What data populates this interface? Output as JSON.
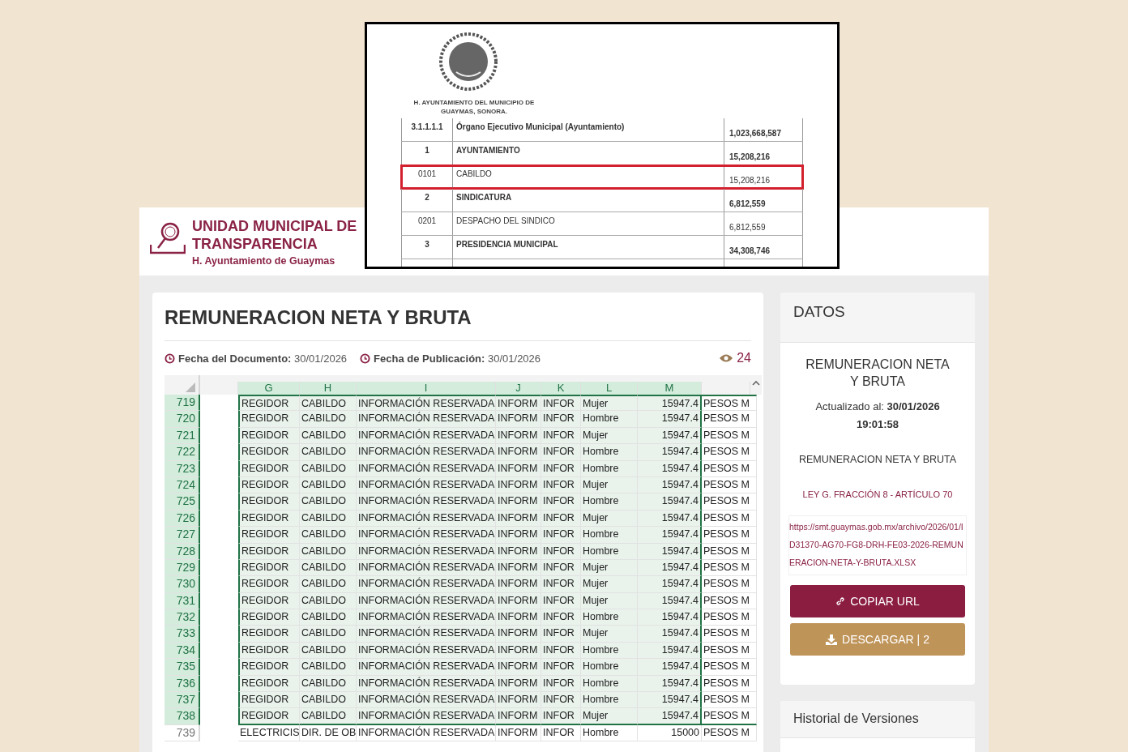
{
  "document_scan": {
    "issuer": "H. AYUNTAMIENTO DEL MUNICIPIO DE GUAYMAS, SONORA.",
    "rows": [
      {
        "code": "3.1.1.1.1",
        "name": "Órgano Ejecutivo Municipal (Ayuntamiento)",
        "amount": "1,023,668,587",
        "bold": true,
        "highlighted": false
      },
      {
        "code": "1",
        "name": "AYUNTAMIENTO",
        "amount": "15,208,216",
        "bold": true,
        "highlighted": false
      },
      {
        "code": "0101",
        "name": "CABILDO",
        "amount": "15,208,216",
        "bold": false,
        "highlighted": true
      },
      {
        "code": "2",
        "name": "SINDICATURA",
        "amount": "6,812,559",
        "bold": true,
        "highlighted": false
      },
      {
        "code": "0201",
        "name": "DESPACHO DEL SINDICO",
        "amount": "6,812,559",
        "bold": false,
        "highlighted": false
      },
      {
        "code": "3",
        "name": "PRESIDENCIA MUNICIPAL",
        "amount": "34,308,746",
        "bold": true,
        "highlighted": false
      }
    ]
  },
  "header": {
    "title_line1": "UNIDAD MUNICIPAL DE",
    "title_line2": "TRANSPARENCIA",
    "subtitle": "H. Ayuntamiento de Guaymas"
  },
  "document": {
    "title": "REMUNERACION NETA Y BRUTA",
    "doc_date_label": "Fecha del Documento:",
    "doc_date": "30/01/2026",
    "pub_date_label": "Fecha de Publicación:",
    "pub_date": "30/01/2026",
    "views": "24"
  },
  "sheet": {
    "columns": [
      "",
      "G",
      "H",
      "I",
      "J",
      "K",
      "L",
      "M"
    ],
    "rows": [
      {
        "num": "719",
        "selected": true,
        "cells": [
          "",
          "REGIDOR",
          "CABILDO",
          "INFORMACIÓN RESERVADA",
          "INFORM",
          "INFOR",
          "Mujer",
          "15947.4",
          "PESOS M"
        ]
      },
      {
        "num": "720",
        "selected": true,
        "cells": [
          "",
          "REGIDOR",
          "CABILDO",
          "INFORMACIÓN RESERVADA",
          "INFORM",
          "INFOR",
          "Hombre",
          "15947.4",
          "PESOS M"
        ]
      },
      {
        "num": "721",
        "selected": true,
        "cells": [
          "",
          "REGIDOR",
          "CABILDO",
          "INFORMACIÓN RESERVADA",
          "INFORM",
          "INFOR",
          "Mujer",
          "15947.4",
          "PESOS M"
        ]
      },
      {
        "num": "722",
        "selected": true,
        "cells": [
          "",
          "REGIDOR",
          "CABILDO",
          "INFORMACIÓN RESERVADA",
          "INFORM",
          "INFOR",
          "Hombre",
          "15947.4",
          "PESOS M"
        ]
      },
      {
        "num": "723",
        "selected": true,
        "cells": [
          "",
          "REGIDOR",
          "CABILDO",
          "INFORMACIÓN RESERVADA",
          "INFORM",
          "INFOR",
          "Hombre",
          "15947.4",
          "PESOS M"
        ]
      },
      {
        "num": "724",
        "selected": true,
        "cells": [
          "",
          "REGIDOR",
          "CABILDO",
          "INFORMACIÓN RESERVADA",
          "INFORM",
          "INFOR",
          "Mujer",
          "15947.4",
          "PESOS M"
        ]
      },
      {
        "num": "725",
        "selected": true,
        "cells": [
          "",
          "REGIDOR",
          "CABILDO",
          "INFORMACIÓN RESERVADA",
          "INFORM",
          "INFOR",
          "Hombre",
          "15947.4",
          "PESOS M"
        ]
      },
      {
        "num": "726",
        "selected": true,
        "cells": [
          "",
          "REGIDOR",
          "CABILDO",
          "INFORMACIÓN RESERVADA",
          "INFORM",
          "INFOR",
          "Mujer",
          "15947.4",
          "PESOS M"
        ]
      },
      {
        "num": "727",
        "selected": true,
        "cells": [
          "",
          "REGIDOR",
          "CABILDO",
          "INFORMACIÓN RESERVADA",
          "INFORM",
          "INFOR",
          "Hombre",
          "15947.4",
          "PESOS M"
        ]
      },
      {
        "num": "728",
        "selected": true,
        "cells": [
          "",
          "REGIDOR",
          "CABILDO",
          "INFORMACIÓN RESERVADA",
          "INFORM",
          "INFOR",
          "Hombre",
          "15947.4",
          "PESOS M"
        ]
      },
      {
        "num": "729",
        "selected": true,
        "cells": [
          "",
          "REGIDOR",
          "CABILDO",
          "INFORMACIÓN RESERVADA",
          "INFORM",
          "INFOR",
          "Mujer",
          "15947.4",
          "PESOS M"
        ]
      },
      {
        "num": "730",
        "selected": true,
        "cells": [
          "",
          "REGIDOR",
          "CABILDO",
          "INFORMACIÓN RESERVADA",
          "INFORM",
          "INFOR",
          "Mujer",
          "15947.4",
          "PESOS M"
        ]
      },
      {
        "num": "731",
        "selected": true,
        "cells": [
          "",
          "REGIDOR",
          "CABILDO",
          "INFORMACIÓN RESERVADA",
          "INFORM",
          "INFOR",
          "Mujer",
          "15947.4",
          "PESOS M"
        ]
      },
      {
        "num": "732",
        "selected": true,
        "cells": [
          "",
          "REGIDOR",
          "CABILDO",
          "INFORMACIÓN RESERVADA",
          "INFORM",
          "INFOR",
          "Hombre",
          "15947.4",
          "PESOS M"
        ]
      },
      {
        "num": "733",
        "selected": true,
        "cells": [
          "",
          "REGIDOR",
          "CABILDO",
          "INFORMACIÓN RESERVADA",
          "INFORM",
          "INFOR",
          "Mujer",
          "15947.4",
          "PESOS M"
        ]
      },
      {
        "num": "734",
        "selected": true,
        "cells": [
          "",
          "REGIDOR",
          "CABILDO",
          "INFORMACIÓN RESERVADA",
          "INFORM",
          "INFOR",
          "Hombre",
          "15947.4",
          "PESOS M"
        ]
      },
      {
        "num": "735",
        "selected": true,
        "cells": [
          "",
          "REGIDOR",
          "CABILDO",
          "INFORMACIÓN RESERVADA",
          "INFORM",
          "INFOR",
          "Hombre",
          "15947.4",
          "PESOS M"
        ]
      },
      {
        "num": "736",
        "selected": true,
        "cells": [
          "",
          "REGIDOR",
          "CABILDO",
          "INFORMACIÓN RESERVADA",
          "INFORM",
          "INFOR",
          "Hombre",
          "15947.4",
          "PESOS M"
        ]
      },
      {
        "num": "737",
        "selected": true,
        "cells": [
          "",
          "REGIDOR",
          "CABILDO",
          "INFORMACIÓN RESERVADA",
          "INFORM",
          "INFOR",
          "Hombre",
          "15947.4",
          "PESOS M"
        ]
      },
      {
        "num": "738",
        "selected": true,
        "cells": [
          "",
          "REGIDOR",
          "CABILDO",
          "INFORMACIÓN RESERVADA",
          "INFORM",
          "INFOR",
          "Mujer",
          "15947.4",
          "PESOS M"
        ]
      },
      {
        "num": "739",
        "selected": false,
        "cells": [
          "",
          "ELECTRICIS",
          "DIR. DE OB",
          "INFORMACIÓN RESERVADA",
          "INFORM",
          "INFOR",
          "Hombre",
          "15000",
          "PESOS M"
        ]
      }
    ]
  },
  "datos": {
    "heading": "DATOS",
    "title": "REMUNERACION NETA Y BRUTA",
    "updated_label": "Actualizado al:",
    "updated_value": "30/01/2026 19:01:58",
    "category": "REMUNERACION NETA Y BRUTA",
    "law": "LEY G. FRACCIÓN 8 - ARTÍCULO 70",
    "url": "https://smt.guaymas.gob.mx/archivo/2026/01/ID31370-AG70-FG8-DRH-FE03-2026-REMUNERACION-NETA-Y-BRUTA.XLSX",
    "copy_button": "COPIAR URL",
    "download_button": "DESCARGAR | 2"
  },
  "history": {
    "heading": "Historial de Versiones"
  }
}
